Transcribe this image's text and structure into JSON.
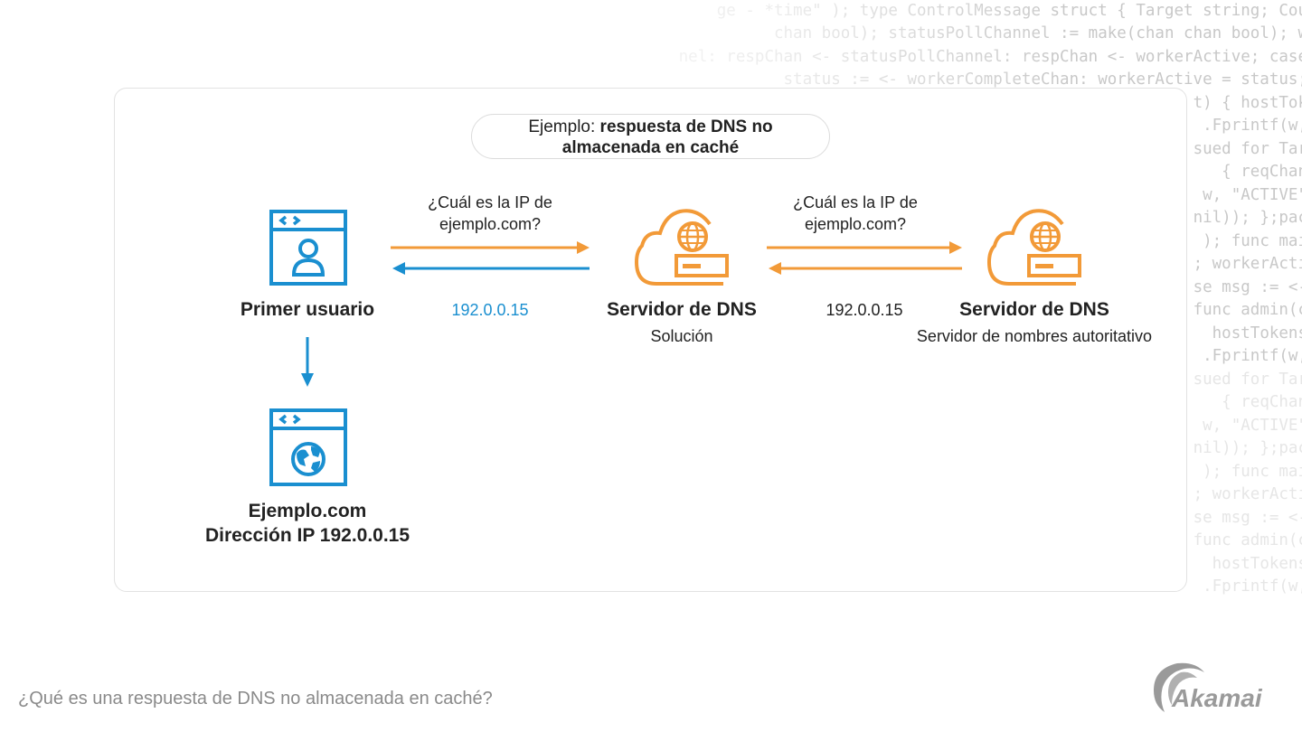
{
  "background_code": [
    "ge - *time\" ); type ControlMessage struct { Target string; Cou",
    "chan bool); statusPollChannel := make(chan chan bool); w",
    "nel: respChan <- statusPollChannel: respChan <- workerActive; case",
    "status := <- workerCompleteChan: workerActive = status;",
    "t) { hostTok",
    ".Fprintf(w,",
    "sued for Tar",
    " { reqChan",
    "w, \"ACTIVE\"",
    "nil)); };pac",
    " ); func mai",
    "; workerActi",
    "se msg := <-",
    "func admin(c",
    "hostTokens",
    ".Fprintf(w,",
    "sued for Tar",
    " { reqChan",
    "w, \"ACTIVE\"",
    "nil)); };pac",
    " ); func mai",
    "; workerActi",
    "se msg := <-",
    "func admin(c",
    "hostTokens",
    ".Fprintf(w,"
  ],
  "diagram": {
    "title_prefix": "Ejemplo: ",
    "title_bold_line1": "respuesta de DNS no",
    "title_bold_line2": "almacenada en caché",
    "nodes": {
      "user": {
        "title": "Primer usuario",
        "icon": "browser-user-icon"
      },
      "resolver": {
        "title": "Servidor de DNS",
        "subtitle": "Solución",
        "icon": "cloud-dns-server-icon"
      },
      "authoritative": {
        "title": "Servidor de DNS",
        "subtitle": "Servidor de nombres autoritativo",
        "icon": "cloud-dns-server-icon"
      },
      "website": {
        "title_line1": "Ejemplo.com",
        "title_line2": "Dirección IP 192.0.0.15",
        "icon": "browser-globe-icon"
      }
    },
    "edges": {
      "user_to_resolver": {
        "query_line1": "¿Cuál es la IP de",
        "query_line2": "ejemplo.com?",
        "response": "192.0.0.15"
      },
      "resolver_to_authoritative": {
        "query_line1": "¿Cuál es la IP de",
        "query_line2": "ejemplo.com?",
        "response": "192.0.0.15"
      }
    }
  },
  "colors": {
    "orange": "#f29a38",
    "blue": "#1a8fd0",
    "text": "#222222",
    "caption": "#8a8a8a"
  },
  "caption": "¿Qué es una respuesta de DNS no almacenada en caché?",
  "logo": {
    "text": "Akamai"
  }
}
